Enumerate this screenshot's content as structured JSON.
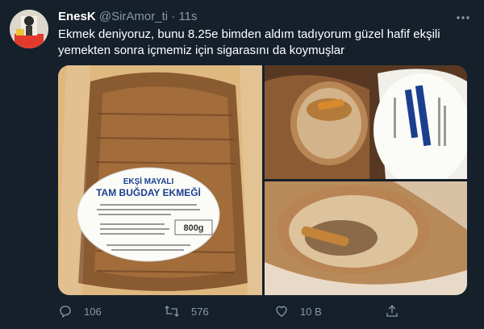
{
  "tweet": {
    "display_name": "EnesK",
    "handle": "@SirAmor_ti",
    "separator": "·",
    "time": "11s",
    "text_line1": "Ekmek deniyoruz, bunu 8.25e bimden aldım tadıyorum güzel hafif ekşili",
    "text_line2": "yemekten sonra içmemiz için sigarasını da koymuşlar"
  },
  "bread_label": {
    "line1": "EKŞİ MAYALI",
    "line2": "TAM BUĞDAY EKMEĞİ",
    "weight": "800g"
  },
  "actions": {
    "replies": "106",
    "retweets": "576",
    "likes": "10 B"
  },
  "icons": {
    "more": "more-icon",
    "reply": "reply-icon",
    "retweet": "retweet-icon",
    "like": "heart-icon",
    "share": "share-icon"
  },
  "colors": {
    "background": "#15202b",
    "secondary_text": "#8899a6"
  }
}
